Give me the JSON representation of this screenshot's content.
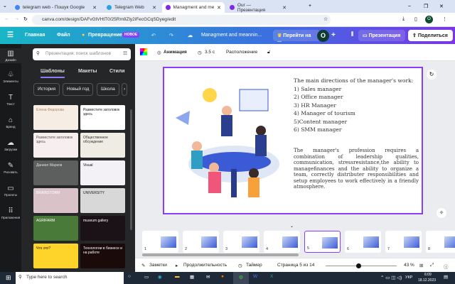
{
  "browser": {
    "tabs": [
      {
        "title": "telegram web - Пошук Google",
        "active": false
      },
      {
        "title": "Telegram Web",
        "active": false
      },
      {
        "title": "Managment and meanning of t",
        "active": true
      },
      {
        "title": "Our — Презентация",
        "active": false
      }
    ],
    "url": "canva.com/design/DAFvGtVHtT0/25Rm9Zly2iFecGCqSDyeg/edit",
    "profile": "O"
  },
  "header": {
    "home": "Главная",
    "file": "Файл",
    "transform": "Превращение",
    "new_badge": "НОВОЕ",
    "title": "Managment and meannin...",
    "upgrade": "Перейти на ...",
    "avatar": "O",
    "present": "Презентация",
    "share": "Поделиться"
  },
  "rail": [
    {
      "icon": "▥",
      "label": "Дизайн"
    },
    {
      "icon": "♧",
      "label": "Элементы"
    },
    {
      "icon": "T",
      "label": "Текст"
    },
    {
      "icon": "⌂",
      "label": "Бренд"
    },
    {
      "icon": "☁",
      "label": "Загрузки"
    },
    {
      "icon": "✎",
      "label": "Рисовать"
    },
    {
      "icon": "▭",
      "label": "Проекты"
    },
    {
      "icon": "⠿",
      "label": "Приложения"
    }
  ],
  "panel": {
    "search_placeholder": "Презентация: поиск шаблонов",
    "tabs": [
      "Шаблоны",
      "Макеты",
      "Стили"
    ],
    "chips": [
      "История",
      "Новый год",
      "Школа"
    ],
    "templates": [
      {
        "text": "Елена Федорова",
        "bg": "#f6ede4",
        "fg": "#b5865a"
      },
      {
        "text": "Разместите заголовок здесь",
        "bg": "#ffffff",
        "fg": "#222"
      },
      {
        "text": "Разместите заголовок здесь",
        "bg": "#f7eef0",
        "fg": "#555"
      },
      {
        "text": "Общественное обсуждение",
        "bg": "#efece4",
        "fg": "#333"
      },
      {
        "text": "Даниил Марков",
        "bg": "#5d5e5e",
        "fg": "#ddd"
      },
      {
        "text": "Visual",
        "bg": "#f3f1f6",
        "fg": "#111"
      },
      {
        "text": "BRAINSTORM",
        "bg": "#d9c2c8",
        "fg": "#fff"
      },
      {
        "text": "UNIVERSITY",
        "bg": "#d8d8d8",
        "fg": "#222"
      },
      {
        "text": "AGRIFARM",
        "bg": "#4a7a3a",
        "fg": "#fff"
      },
      {
        "text": "museum gallery",
        "bg": "#1a1216",
        "fg": "#fff"
      },
      {
        "text": "Что это?",
        "bg": "#ffd42a",
        "fg": "#111"
      },
      {
        "text": "Технологии в бизнесе и на работе",
        "bg": "#1a0a0a",
        "fg": "#fff"
      }
    ]
  },
  "toolbar": {
    "animation": "Анимация",
    "duration": "3.5 с",
    "position": "Расположение"
  },
  "slide": {
    "heading": "The main directions of the manager's work:",
    "items": [
      "1) Sales manager",
      "2) Office manager",
      "3) HR Manager",
      "4) Manager of tourism",
      "5)Content manager",
      "6) SMM manager"
    ],
    "paragraph": "The manager's profession requires a combination of leadership qualities, communication, stressresistance,the ability to managefinances and the ability to organize a team, correctly distributer responsibilities and setup employees to work effectively in a friendly atmosphere."
  },
  "pages": [
    "1",
    "2",
    "3",
    "4",
    "5",
    "6",
    "7",
    "8"
  ],
  "current_page_index": 4,
  "bottom": {
    "notes": "Заметки",
    "duration": "Продолжительность",
    "timer": "Таймер",
    "page": "Страница 5 из 14",
    "zoom": "43 %",
    "zoom_fraction": 0.45
  },
  "taskbar": {
    "search": "Type here to search",
    "lang": "УКР",
    "time": "6:09",
    "date": "18.12.2023"
  },
  "colors": {
    "accent": "#8b3dff",
    "rail": "#18191b",
    "panel": "#252627"
  }
}
